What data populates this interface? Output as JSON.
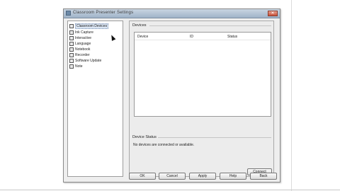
{
  "window": {
    "title": "Classroom Presenter Settings"
  },
  "nav": {
    "items": [
      {
        "label": "Classroom Devices",
        "icon": "devices-icon",
        "selected": true
      },
      {
        "label": "Ink Capture",
        "icon": "ink-capture-icon"
      },
      {
        "label": "Interactive",
        "icon": "interactive-icon"
      },
      {
        "label": "Language",
        "icon": "language-icon"
      },
      {
        "label": "Notebook",
        "icon": "notebook-icon"
      },
      {
        "label": "Recorder",
        "icon": "recorder-icon"
      },
      {
        "label": "Software Update",
        "icon": "software-update-icon"
      },
      {
        "label": "Note",
        "icon": "note-icon"
      }
    ]
  },
  "devices": {
    "title": "Devices",
    "columns": [
      "Device",
      "ID",
      "Status"
    ]
  },
  "device_status": {
    "title": "Device Status",
    "message": "No devices are connected or available."
  },
  "buttons": {
    "connect": "Connect",
    "ok": "OK",
    "cancel": "Cancel",
    "apply": "Apply",
    "help": "Help",
    "back": "Back"
  }
}
